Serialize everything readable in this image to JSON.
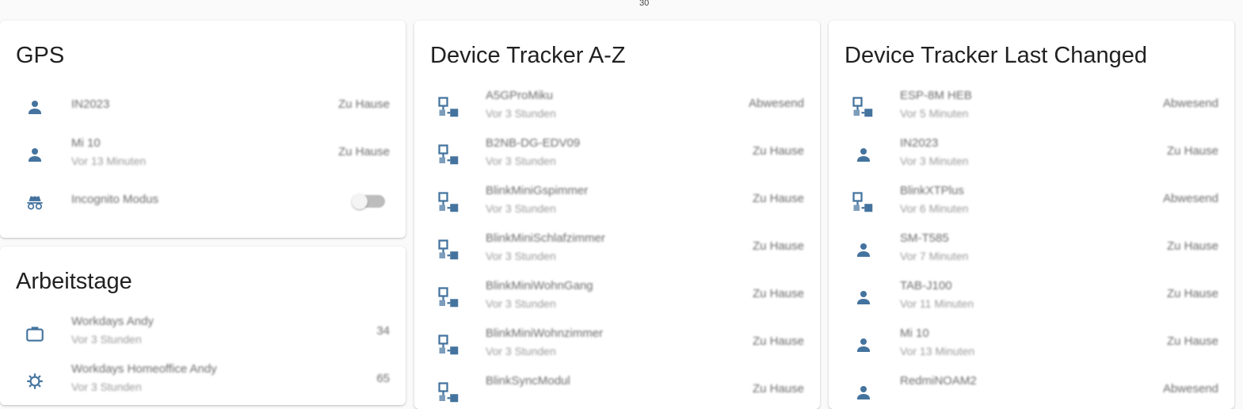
{
  "top_value": "30",
  "colors": {
    "icon": "#44739e",
    "card": "#ffffff",
    "background": "#fafafa"
  },
  "gps": {
    "title": "GPS",
    "items": [
      {
        "icon": "account-icon",
        "name": "IN2023",
        "state": "Zu Hause"
      },
      {
        "icon": "account-icon",
        "name": "Mi 10",
        "sub": "Vor 13 Minuten",
        "state": "Zu Hause"
      },
      {
        "icon": "incognito-icon",
        "name": "Incognito Modus",
        "toggle": "off"
      }
    ]
  },
  "arbeitstage": {
    "title": "Arbeitstage",
    "items": [
      {
        "icon": "briefcase-icon",
        "name": "Workdays Andy",
        "sub": "Vor 3 Stunden",
        "state": "34"
      },
      {
        "icon": "home-gear-icon",
        "name": "Workdays Homeoffice Andy",
        "sub": "Vor 3 Stunden",
        "state": "65"
      }
    ]
  },
  "tracker_az": {
    "title": "Device Tracker A-Z",
    "items": [
      {
        "icon": "lan-icon",
        "name": "A5GProMiku",
        "sub": "Vor 3 Stunden",
        "state": "Abwesend"
      },
      {
        "icon": "lan-icon",
        "name": "B2NB-DG-EDV09",
        "sub": "Vor 3 Stunden",
        "state": "Zu Hause"
      },
      {
        "icon": "lan-icon",
        "name": "BlinkMiniGspimmer",
        "sub": "Vor 3 Stunden",
        "state": "Zu Hause"
      },
      {
        "icon": "lan-icon",
        "name": "BlinkMiniSchlafzimmer",
        "sub": "Vor 3 Stunden",
        "state": "Zu Hause"
      },
      {
        "icon": "lan-icon",
        "name": "BlinkMiniWohnGang",
        "sub": "Vor 3 Stunden",
        "state": "Zu Hause"
      },
      {
        "icon": "lan-icon",
        "name": "BlinkMiniWohnzimmer",
        "sub": "Vor 3 Stunden",
        "state": "Zu Hause"
      },
      {
        "icon": "lan-icon",
        "name": "BlinkSyncModul",
        "sub": "",
        "state": "Zu Hause"
      }
    ]
  },
  "tracker_last": {
    "title": "Device Tracker Last Changed",
    "items": [
      {
        "icon": "lan-icon",
        "name": "ESP-8M HEB",
        "sub": "Vor 5 Minuten",
        "state": "Abwesend"
      },
      {
        "icon": "account-icon",
        "name": "IN2023",
        "sub": "Vor 3 Minuten",
        "state": "Zu Hause"
      },
      {
        "icon": "lan-icon",
        "name": "BlinkXTPlus",
        "sub": "Vor 6 Minuten",
        "state": "Abwesend"
      },
      {
        "icon": "account-icon",
        "name": "SM-T585",
        "sub": "Vor 7 Minuten",
        "state": "Zu Hause"
      },
      {
        "icon": "account-icon",
        "name": "TAB-J100",
        "sub": "Vor 11 Minuten",
        "state": "Zu Hause"
      },
      {
        "icon": "account-icon",
        "name": "Mi 10",
        "sub": "Vor 13 Minuten",
        "state": "Zu Hause"
      },
      {
        "icon": "account-icon",
        "name": "RedmiNOAM2",
        "sub": "",
        "state": "Abwesend"
      }
    ]
  }
}
